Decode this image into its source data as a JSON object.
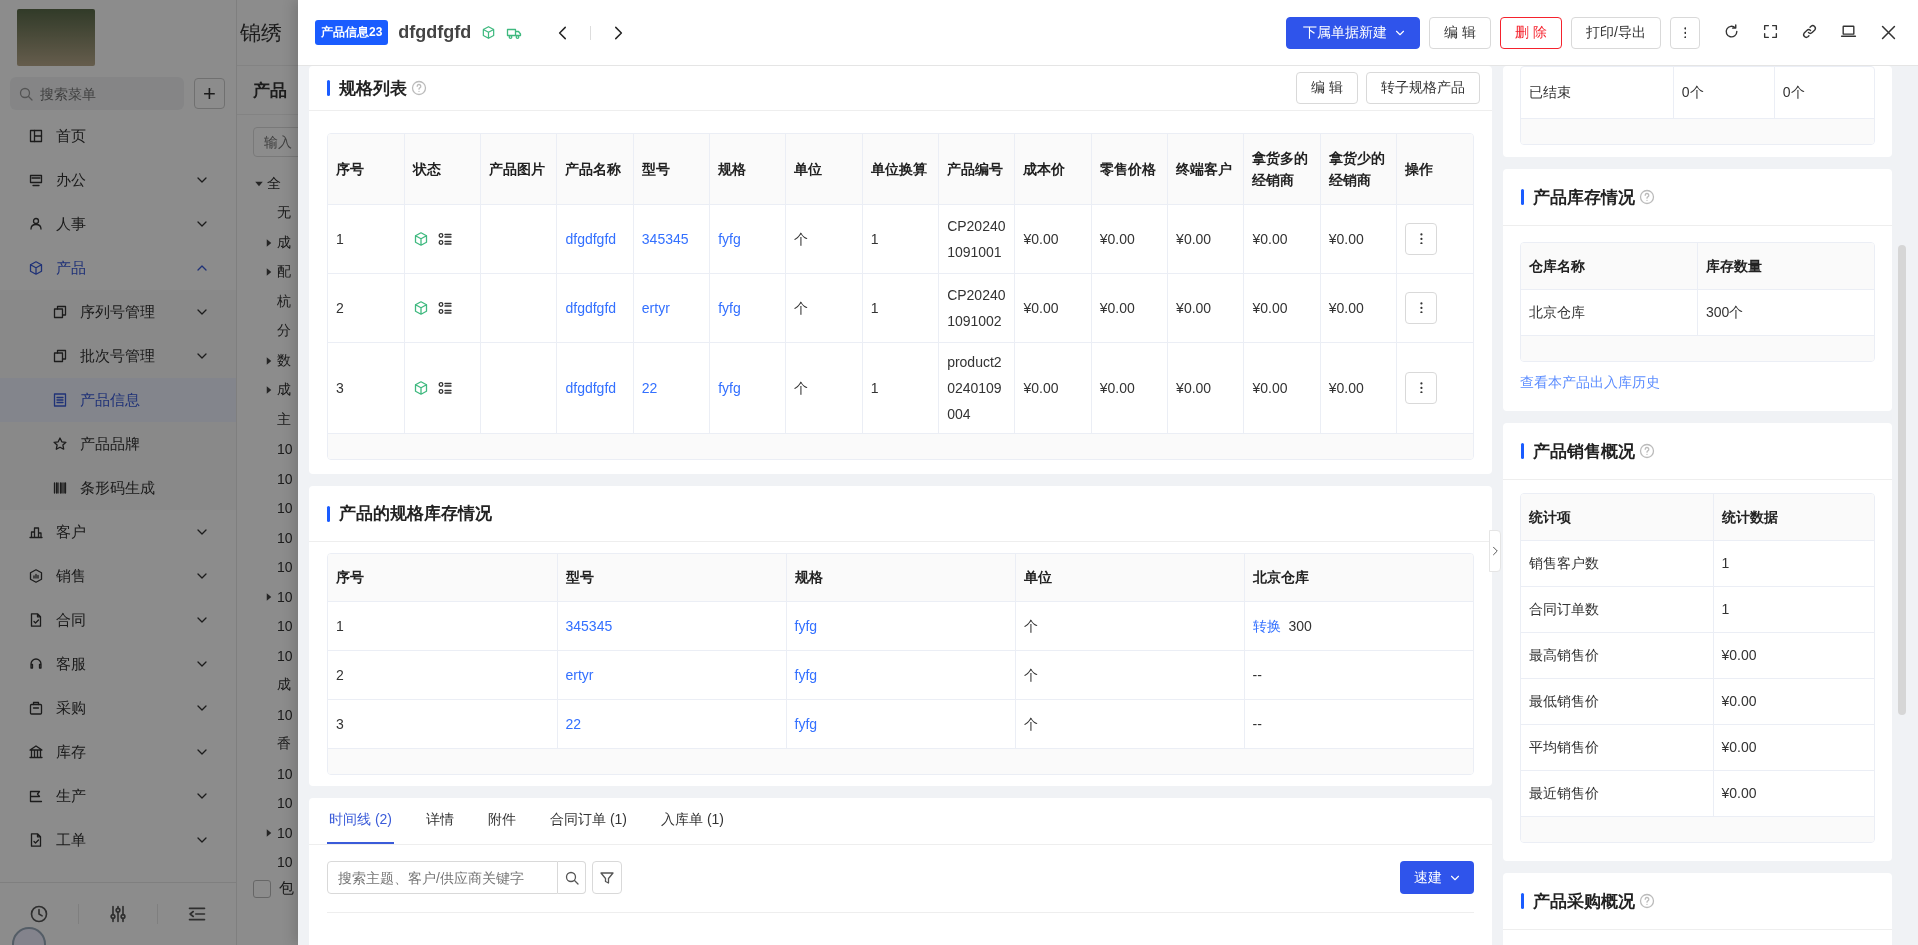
{
  "background": {
    "company": "锦绣",
    "sidebar": {
      "search_placeholder": "搜索菜单",
      "add_button": "+",
      "items": [
        {
          "label": "首页",
          "kind": "link",
          "selected": false
        },
        {
          "label": "办公",
          "kind": "group",
          "expanded": false,
          "selected": false
        },
        {
          "label": "人事",
          "kind": "group",
          "expanded": false,
          "selected": false
        },
        {
          "label": "产品",
          "kind": "group",
          "expanded": true,
          "selected": true,
          "children": [
            {
              "label": "序列号管理",
              "kind": "group",
              "expanded": false,
              "selected": false
            },
            {
              "label": "批次号管理",
              "kind": "group",
              "expanded": false,
              "selected": false
            },
            {
              "label": "产品信息",
              "kind": "link",
              "selected": true
            },
            {
              "label": "产品品牌",
              "kind": "link",
              "selected": false
            },
            {
              "label": "条形码生成",
              "kind": "link",
              "selected": false
            }
          ]
        },
        {
          "label": "客户",
          "kind": "group",
          "expanded": false,
          "selected": false
        },
        {
          "label": "销售",
          "kind": "group",
          "expanded": false,
          "selected": false
        },
        {
          "label": "合同",
          "kind": "group",
          "expanded": false,
          "selected": false
        },
        {
          "label": "客服",
          "kind": "group",
          "expanded": false,
          "selected": false
        },
        {
          "label": "采购",
          "kind": "group",
          "expanded": false,
          "selected": false
        },
        {
          "label": "库存",
          "kind": "group",
          "expanded": false,
          "selected": false
        },
        {
          "label": "生产",
          "kind": "group",
          "expanded": false,
          "selected": false
        },
        {
          "label": "工单",
          "kind": "group",
          "expanded": false,
          "selected": false
        }
      ]
    },
    "tree_panel": {
      "title": "产品",
      "filter_placeholder": "输入",
      "nodes": [
        {
          "label": "全",
          "kind": "branch",
          "expanded": true,
          "children": [
            {
              "label": "无",
              "kind": "leaf"
            },
            {
              "label": "成",
              "kind": "branch",
              "expanded": false
            },
            {
              "label": "配",
              "kind": "branch",
              "expanded": false
            },
            {
              "label": "杭",
              "kind": "leaf"
            },
            {
              "label": "分",
              "kind": "leaf"
            },
            {
              "label": "数",
              "kind": "branch",
              "expanded": false
            },
            {
              "label": "成",
              "kind": "branch",
              "expanded": false
            },
            {
              "label": "主",
              "kind": "leaf"
            },
            {
              "label": "10",
              "kind": "leaf"
            },
            {
              "label": "10",
              "kind": "leaf"
            },
            {
              "label": "10",
              "kind": "leaf"
            },
            {
              "label": "10",
              "kind": "leaf"
            },
            {
              "label": "10",
              "kind": "leaf"
            },
            {
              "label": "10",
              "kind": "branch",
              "expanded": false
            },
            {
              "label": "10",
              "kind": "leaf"
            },
            {
              "label": "10",
              "kind": "leaf"
            },
            {
              "label": "成",
              "kind": "leaf"
            },
            {
              "label": "10",
              "kind": "leaf"
            },
            {
              "label": "香",
              "kind": "leaf"
            },
            {
              "label": "10",
              "kind": "leaf"
            },
            {
              "label": "10",
              "kind": "leaf"
            },
            {
              "label": "10",
              "kind": "branch",
              "expanded": false
            },
            {
              "label": "10",
              "kind": "leaf"
            }
          ]
        }
      ],
      "checkbox": {
        "label": "包",
        "checked": false
      }
    }
  },
  "drawer": {
    "tag": "产品信息23",
    "title": "dfgdfgfd",
    "actions": [
      {
        "label": "下属单据新建",
        "kind": "primary",
        "dropdown": true
      },
      {
        "label": "编 辑",
        "kind": "default",
        "dropdown": false
      },
      {
        "label": "删 除",
        "kind": "danger",
        "dropdown": false
      },
      {
        "label": "打印/导出",
        "kind": "default",
        "dropdown": false
      }
    ],
    "main": [
      {
        "kind": "table",
        "title": "规格列表",
        "has_help": true,
        "buttons": [
          "编 辑",
          "转子规格产品"
        ],
        "table": {
          "columns": [
            {
              "label": "序号",
              "kind": "text"
            },
            {
              "label": "状态",
              "kind": "status"
            },
            {
              "label": "产品图片",
              "kind": "image"
            },
            {
              "label": "产品名称",
              "kind": "link"
            },
            {
              "label": "型号",
              "kind": "link"
            },
            {
              "label": "规格",
              "kind": "link"
            },
            {
              "label": "单位",
              "kind": "text"
            },
            {
              "label": "单位换算",
              "kind": "text"
            },
            {
              "label": "产品编号",
              "kind": "code"
            },
            {
              "label": "成本价",
              "kind": "text"
            },
            {
              "label": "零售价格",
              "kind": "text"
            },
            {
              "label": "终端客户",
              "kind": "text"
            },
            {
              "label": "拿货多的经销商",
              "kind": "text"
            },
            {
              "label": "拿货少的经销商",
              "kind": "text"
            },
            {
              "label": "操作",
              "kind": "actions"
            }
          ],
          "rows": [
            [
              "1",
              "",
              "",
              "dfgdfgfd",
              "345345",
              "fyfg",
              "个",
              "1",
              "CP202401091001",
              "¥0.00",
              "¥0.00",
              "¥0.00",
              "¥0.00",
              "¥0.00",
              ""
            ],
            [
              "2",
              "",
              "",
              "dfgdfgfd",
              "ertyr",
              "fyfg",
              "个",
              "1",
              "CP202401091002",
              "¥0.00",
              "¥0.00",
              "¥0.00",
              "¥0.00",
              "¥0.00",
              ""
            ],
            [
              "3",
              "",
              "",
              "dfgdfgfd",
              "22",
              "fyfg",
              "个",
              "1",
              "product20240109004",
              "¥0.00",
              "¥0.00",
              "¥0.00",
              "¥0.00",
              "¥0.00",
              ""
            ]
          ]
        }
      },
      {
        "kind": "table",
        "title": "产品的规格库存情况",
        "has_help": false,
        "table": {
          "columns": [
            {
              "label": "序号",
              "kind": "text"
            },
            {
              "label": "型号",
              "kind": "link"
            },
            {
              "label": "规格",
              "kind": "link"
            },
            {
              "label": "单位",
              "kind": "text"
            },
            {
              "label": "北京仓库",
              "kind": "stock"
            }
          ],
          "rows": [
            [
              "1",
              "345345",
              "fyfg",
              "个",
              {
                "action": "转换",
                "value": "300"
              }
            ],
            [
              "2",
              "ertyr",
              "fyfg",
              "个",
              {
                "value": "--"
              }
            ],
            [
              "3",
              "22",
              "fyfg",
              "个",
              {
                "value": "--"
              }
            ]
          ]
        }
      },
      {
        "kind": "tabs",
        "tabs": [
          {
            "label": "时间线 (2)",
            "selected": true
          },
          {
            "label": "详情",
            "selected": false
          },
          {
            "label": "附件",
            "selected": false
          },
          {
            "label": "合同订单 (1)",
            "selected": false
          },
          {
            "label": "入库单 (1)",
            "selected": false
          }
        ],
        "search": {
          "placeholder": "搜索主题、客户/供应商关键字"
        },
        "quick_button": "速建"
      }
    ],
    "side": [
      {
        "kind": "table",
        "table": {
          "rows": [
            [
              "已结束",
              "0个",
              "0个"
            ]
          ]
        }
      },
      {
        "kind": "table",
        "title": "产品库存情况",
        "has_help": true,
        "table": {
          "columns": [
            {
              "label": "仓库名称",
              "kind": "text"
            },
            {
              "label": "库存数量",
              "kind": "text"
            }
          ],
          "rows": [
            [
              "北京仓库",
              "300个"
            ]
          ]
        },
        "link": "查看本产品出入库历史"
      },
      {
        "kind": "table",
        "title": "产品销售概况",
        "has_help": true,
        "table": {
          "columns": [
            {
              "label": "统计项",
              "kind": "text"
            },
            {
              "label": "统计数据",
              "kind": "text"
            }
          ],
          "rows": [
            [
              "销售客户数",
              "1"
            ],
            [
              "合同订单数",
              "1"
            ],
            [
              "最高销售价",
              "¥0.00"
            ],
            [
              "最低销售价",
              "¥0.00"
            ],
            [
              "平均销售价",
              "¥0.00"
            ],
            [
              "最近销售价",
              "¥0.00"
            ]
          ]
        }
      },
      {
        "kind": "table",
        "title": "产品采购概况",
        "has_help": true
      }
    ]
  }
}
